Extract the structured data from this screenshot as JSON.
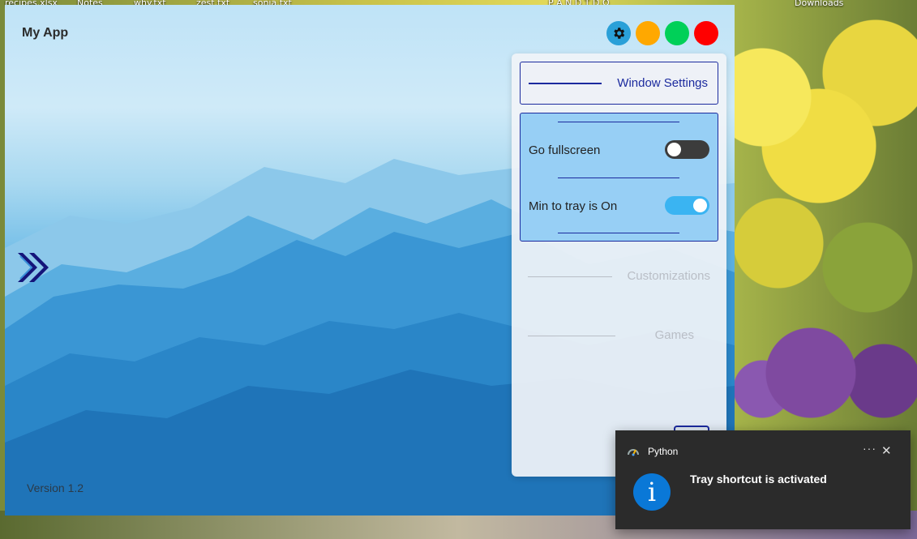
{
  "desktop": {
    "icons": [
      "recipes.xlsx",
      "Notes",
      "why.txt",
      "zest.txt",
      "sonia.txt",
      "P A N D T D O",
      "Downloads"
    ]
  },
  "app": {
    "title": "My App",
    "version": "Version 1.2",
    "controls": {
      "settings_icon": "gear-icon",
      "colors": {
        "settings": "#2aa0d8",
        "minimize": "#ffa800",
        "maximize": "#00d058",
        "close": "#ff0000"
      }
    },
    "sidebar_toggle_icon": "double-chevron-right-icon"
  },
  "settings_panel": {
    "window_settings_label": "Window Settings",
    "fullscreen_label": "Go fullscreen",
    "fullscreen_on": false,
    "min_to_tray_label": "Min to tray is On",
    "min_to_tray_on": true,
    "customizations_label": "Customizations",
    "games_label": "Games",
    "accent_color": "#1b2a9e"
  },
  "toast": {
    "app_name": "Python",
    "more_label": "···",
    "close_label": "✕",
    "message": "Tray shortcut is activated",
    "icon": "info-icon",
    "info_glyph": "i"
  }
}
